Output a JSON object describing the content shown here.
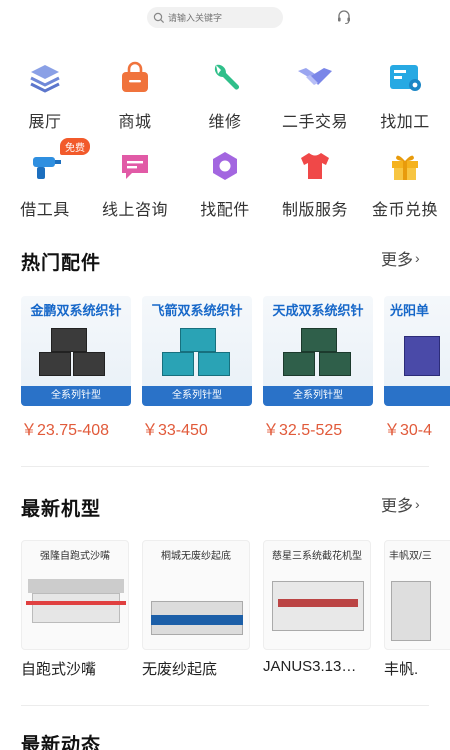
{
  "search": {
    "placeholder": "请输入关键字"
  },
  "grid": [
    {
      "label": "展厅",
      "icon": "layers-icon",
      "color": "#6f88d8"
    },
    {
      "label": "商城",
      "icon": "shopping-bag-icon",
      "color": "#f0733c"
    },
    {
      "label": "维修",
      "icon": "wrench-icon",
      "color": "#2fbf8a"
    },
    {
      "label": "二手交易",
      "icon": "handshake-icon",
      "color": "#7a86e8"
    },
    {
      "label": "找加工",
      "icon": "machine-icon",
      "color": "#27a9e3"
    },
    {
      "label": "借工具",
      "icon": "drill-icon",
      "color": "#2f8fe0",
      "badge": "免费"
    },
    {
      "label": "线上咨询",
      "icon": "chat-icon",
      "color": "#e15aa6"
    },
    {
      "label": "找配件",
      "icon": "gear-icon",
      "color": "#a366e0"
    },
    {
      "label": "制版服务",
      "icon": "shirt-icon",
      "color": "#f04848"
    },
    {
      "label": "金币兑换",
      "icon": "gift-icon",
      "color": "#f5b21d"
    }
  ],
  "hot_parts": {
    "title": "热门配件",
    "more": "更多",
    "items": [
      {
        "name": "金鹏双系统织针",
        "price": "￥23.75-408",
        "box": "#3b3b3b",
        "caption": "全系列针型"
      },
      {
        "name": "飞箭双系统织针",
        "price": "￥33-450",
        "box": "#2aa3b5",
        "caption": "全系列针型"
      },
      {
        "name": "天成双系统织针",
        "price": "￥32.5-525",
        "box": "#2f5f4a",
        "caption": "全系列针型"
      },
      {
        "name": "光阳单",
        "price": "￥30-4",
        "box": "#4a4aa8",
        "caption": ""
      }
    ]
  },
  "new_machines": {
    "title": "最新机型",
    "more": "更多",
    "items": [
      {
        "name": "强隆自跑式沙嘴",
        "title": "自跑式沙嘴"
      },
      {
        "name": "桐城无废纱起底",
        "title": "无废纱起底"
      },
      {
        "name": "慈星三系统截花机型",
        "title": "JANUS3.13…"
      },
      {
        "name": "丰帆双/三",
        "title": "丰帆."
      }
    ]
  },
  "news": {
    "title": "最新动态"
  }
}
